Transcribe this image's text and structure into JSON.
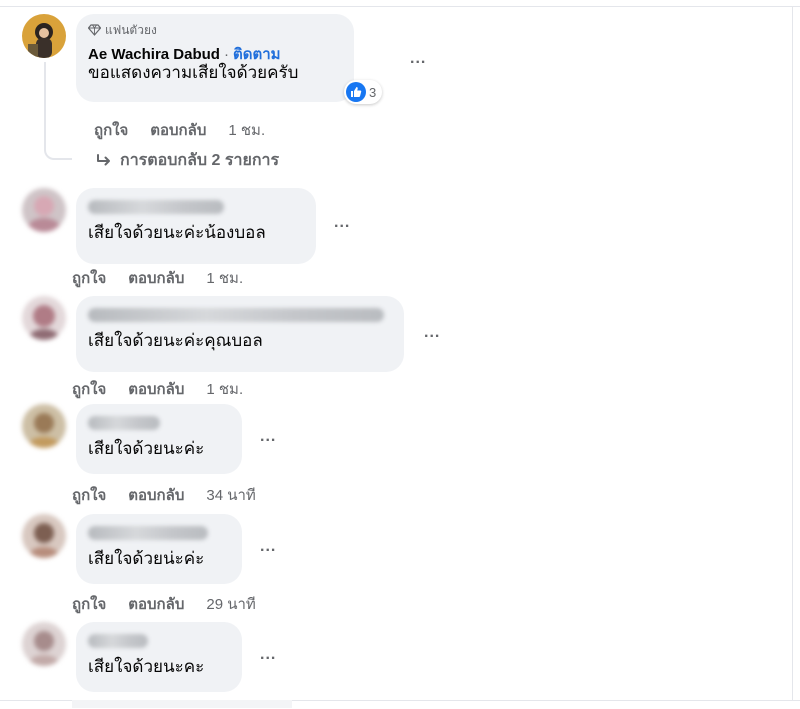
{
  "colors": {
    "bubble": "#f0f2f5",
    "secondary_text": "#65676b",
    "link_blue": "#216fdb",
    "like_blue": "#1877f2"
  },
  "comments": [
    {
      "badge_icon": "diamond-icon",
      "badge": "แฟนตัวยง",
      "author": "Ae Wachira Dabud",
      "separator": "·",
      "follow": "ติดตาม",
      "text": "ขอแสดงความเสียใจด้วยครับ",
      "reaction_icon": "like-icon",
      "reaction_count": "3",
      "more": "...",
      "actions": {
        "like": "ถูกใจ",
        "reply": "ตอบกลับ",
        "time": "1 ชม."
      },
      "view_replies": "การตอบกลับ 2 รายการ"
    },
    {
      "text": "เสียใจด้วยนะค่ะน้องบอล",
      "more": "...",
      "actions": {
        "like": "ถูกใจ",
        "reply": "ตอบกลับ",
        "time": "1 ชม."
      }
    },
    {
      "text": "เสียใจด้วยนะค่ะคุณบอล",
      "more": "...",
      "actions": {
        "like": "ถูกใจ",
        "reply": "ตอบกลับ",
        "time": "1 ชม."
      }
    },
    {
      "text": "เสียใจด้วยนะค่ะ",
      "more": "...",
      "actions": {
        "like": "ถูกใจ",
        "reply": "ตอบกลับ",
        "time": "34 นาที"
      }
    },
    {
      "text": "เสียใจด้วยน่ะค่ะ",
      "more": "...",
      "actions": {
        "like": "ถูกใจ",
        "reply": "ตอบกลับ",
        "time": "29 นาที"
      }
    },
    {
      "text": "เสียใจด้วยนะคะ",
      "more": "..."
    }
  ]
}
